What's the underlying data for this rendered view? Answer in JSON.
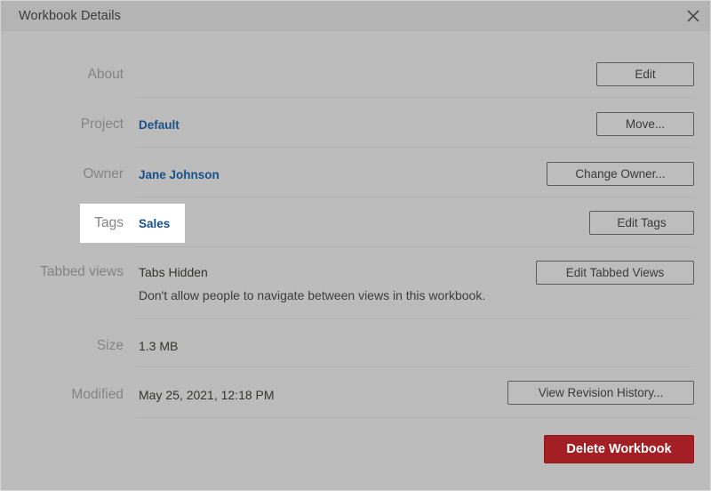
{
  "dialog": {
    "title": "Workbook Details",
    "close_icon": "close-icon"
  },
  "rows": [
    {
      "label": "About",
      "value": "",
      "button": "Edit"
    },
    {
      "label": "Project",
      "value": "Default",
      "button": "Move..."
    },
    {
      "label": "Owner",
      "value": "Jane Johnson",
      "button": "Change Owner..."
    },
    {
      "label": "Tags",
      "value": "Sales",
      "button": "Edit Tags"
    },
    {
      "label": "Tabbed views",
      "value": "Tabs Hidden",
      "description": "Don't allow people to navigate between views in this workbook.",
      "button": "Edit Tabbed Views"
    },
    {
      "label": "Size",
      "value": "1.3 MB",
      "button": ""
    },
    {
      "label": "Modified",
      "value": "May 25, 2021, 12:18 PM",
      "button": "View Revision History..."
    }
  ],
  "footer": {
    "delete_label": "Delete Workbook"
  },
  "colors": {
    "dialog_bg": "#bcbcbc",
    "titlebar_bg": "#b4b4b4",
    "link": "#18518a",
    "danger": "#a41f24",
    "divider": "#b0b0b0",
    "label_text": "#848484"
  }
}
